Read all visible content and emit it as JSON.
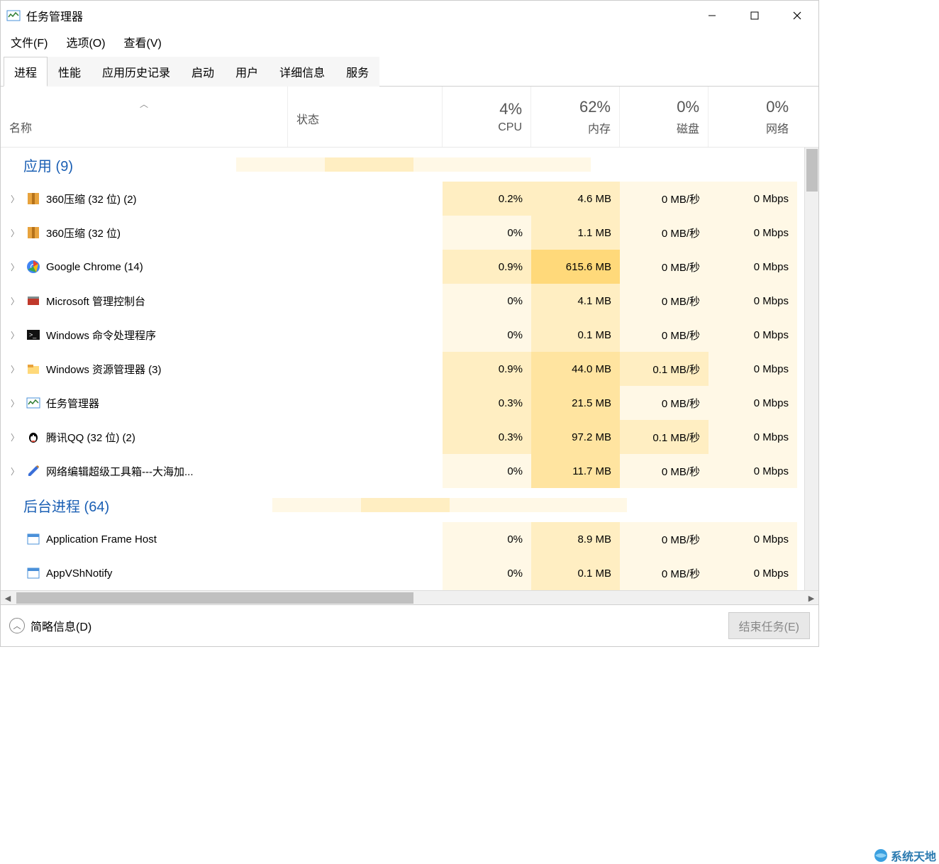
{
  "window": {
    "title": "任务管理器"
  },
  "menu": {
    "file": "文件(F)",
    "options": "选项(O)",
    "view": "查看(V)"
  },
  "tabs": [
    "进程",
    "性能",
    "应用历史记录",
    "启动",
    "用户",
    "详细信息",
    "服务"
  ],
  "active_tab_index": 0,
  "columns": {
    "name": "名称",
    "status": "状态",
    "cpu": {
      "value": "4%",
      "label": "CPU"
    },
    "mem": {
      "value": "62%",
      "label": "内存"
    },
    "disk": {
      "value": "0%",
      "label": "磁盘"
    },
    "net": {
      "value": "0%",
      "label": "网络"
    }
  },
  "groups": {
    "apps": "应用 (9)",
    "background": "后台进程 (64)"
  },
  "apps": [
    {
      "name": "360压缩 (32 位) (2)",
      "cpu": "0.2%",
      "mem": "4.6 MB",
      "disk": "0 MB/秒",
      "net": "0 Mbps",
      "icon": "zip",
      "cpu_heat": 1,
      "mem_heat": 1,
      "disk_heat": 0,
      "net_heat": 0,
      "expand": true
    },
    {
      "name": "360压缩 (32 位)",
      "cpu": "0%",
      "mem": "1.1 MB",
      "disk": "0 MB/秒",
      "net": "0 Mbps",
      "icon": "zip",
      "cpu_heat": 0,
      "mem_heat": 1,
      "disk_heat": 0,
      "net_heat": 0,
      "expand": true
    },
    {
      "name": "Google Chrome (14)",
      "cpu": "0.9%",
      "mem": "615.6 MB",
      "disk": "0 MB/秒",
      "net": "0 Mbps",
      "icon": "chrome",
      "cpu_heat": 1,
      "mem_heat": 3,
      "disk_heat": 0,
      "net_heat": 0,
      "expand": true
    },
    {
      "name": "Microsoft 管理控制台",
      "cpu": "0%",
      "mem": "4.1 MB",
      "disk": "0 MB/秒",
      "net": "0 Mbps",
      "icon": "mmc",
      "cpu_heat": 0,
      "mem_heat": 1,
      "disk_heat": 0,
      "net_heat": 0,
      "expand": true
    },
    {
      "name": "Windows 命令处理程序",
      "cpu": "0%",
      "mem": "0.1 MB",
      "disk": "0 MB/秒",
      "net": "0 Mbps",
      "icon": "cmd",
      "cpu_heat": 0,
      "mem_heat": 1,
      "disk_heat": 0,
      "net_heat": 0,
      "expand": true
    },
    {
      "name": "Windows 资源管理器 (3)",
      "cpu": "0.9%",
      "mem": "44.0 MB",
      "disk": "0.1 MB/秒",
      "net": "0 Mbps",
      "icon": "explorer",
      "cpu_heat": 1,
      "mem_heat": 2,
      "disk_heat": 1,
      "net_heat": 0,
      "expand": true
    },
    {
      "name": "任务管理器",
      "cpu": "0.3%",
      "mem": "21.5 MB",
      "disk": "0 MB/秒",
      "net": "0 Mbps",
      "icon": "taskmgr",
      "cpu_heat": 1,
      "mem_heat": 2,
      "disk_heat": 0,
      "net_heat": 0,
      "expand": true
    },
    {
      "name": "腾讯QQ (32 位) (2)",
      "cpu": "0.3%",
      "mem": "97.2 MB",
      "disk": "0.1 MB/秒",
      "net": "0 Mbps",
      "icon": "qq",
      "cpu_heat": 1,
      "mem_heat": 2,
      "disk_heat": 1,
      "net_heat": 0,
      "expand": true
    },
    {
      "name": "网络编辑超级工具箱---大海加...",
      "cpu": "0%",
      "mem": "11.7 MB",
      "disk": "0 MB/秒",
      "net": "0 Mbps",
      "icon": "pen",
      "cpu_heat": 0,
      "mem_heat": 2,
      "disk_heat": 0,
      "net_heat": 0,
      "expand": true
    }
  ],
  "background": [
    {
      "name": "Application Frame Host",
      "cpu": "0%",
      "mem": "8.9 MB",
      "disk": "0 MB/秒",
      "net": "0 Mbps",
      "icon": "app",
      "cpu_heat": 0,
      "mem_heat": 1,
      "disk_heat": 0,
      "net_heat": 0,
      "expand": false
    },
    {
      "name": "AppVShNotify",
      "cpu": "0%",
      "mem": "0.1 MB",
      "disk": "0 MB/秒",
      "net": "0 Mbps",
      "icon": "app",
      "cpu_heat": 0,
      "mem_heat": 1,
      "disk_heat": 0,
      "net_heat": 0,
      "expand": false
    }
  ],
  "footer": {
    "less_info": "简略信息(D)",
    "end_task": "结束任务(E)"
  },
  "watermark": "系统天地"
}
